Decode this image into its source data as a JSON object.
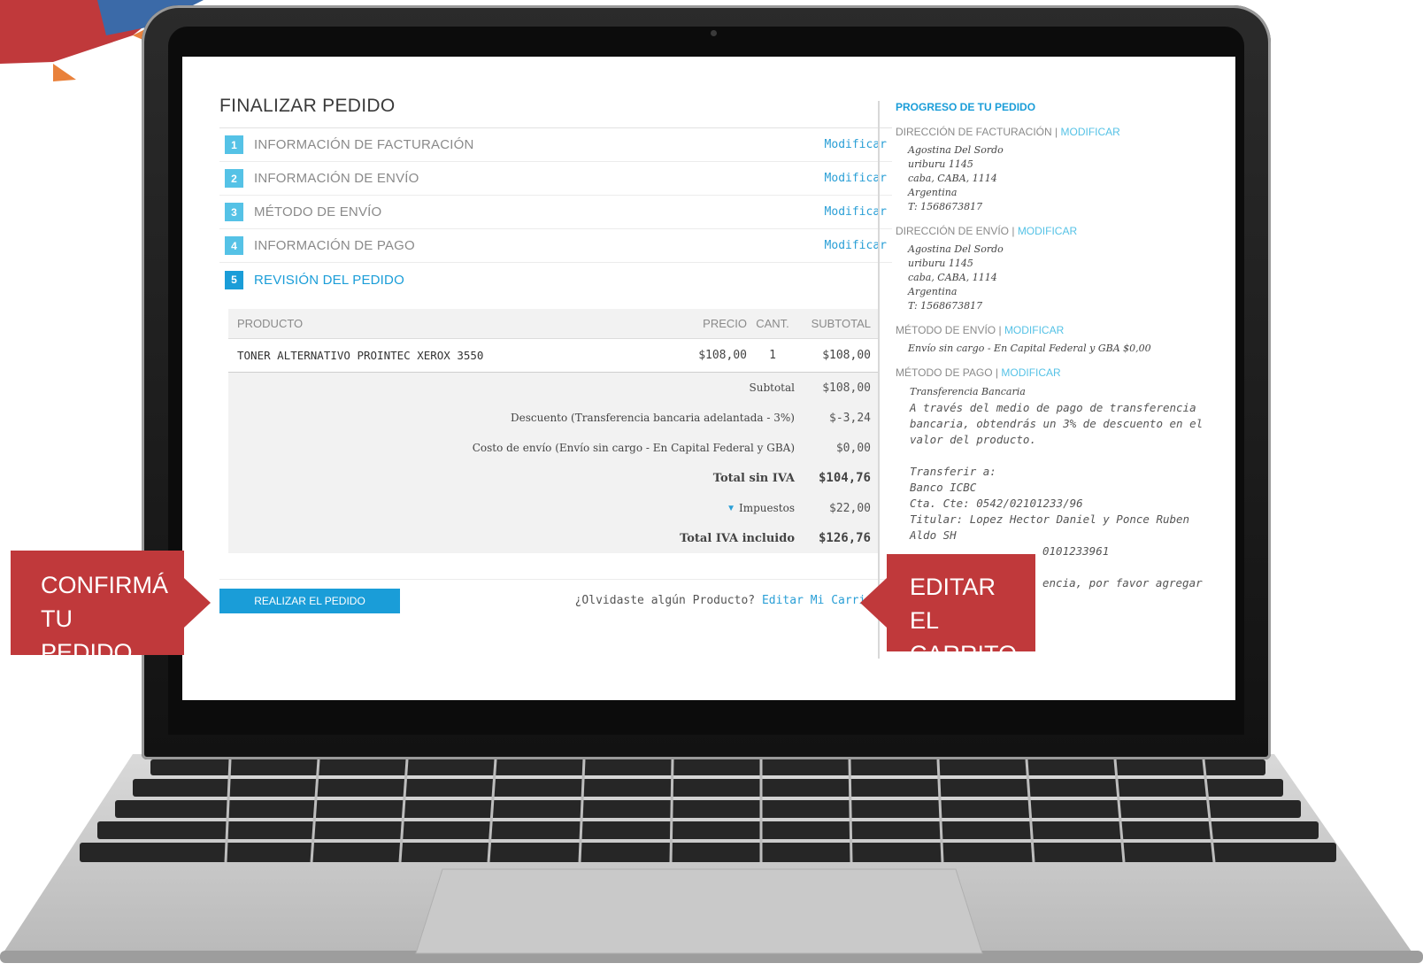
{
  "checkout": {
    "title": "FINALIZAR PEDIDO",
    "steps": [
      {
        "num": "1",
        "label": "INFORMACIÓN DE FACTURACIÓN",
        "action": "Modificar"
      },
      {
        "num": "2",
        "label": "INFORMACIÓN DE ENVÍO",
        "action": "Modificar"
      },
      {
        "num": "3",
        "label": "MÉTODO DE ENVÍO",
        "action": "Modificar"
      },
      {
        "num": "4",
        "label": "INFORMACIÓN DE PAGO",
        "action": "Modificar"
      },
      {
        "num": "5",
        "label": "REVISIÓN DEL PEDIDO"
      }
    ],
    "table": {
      "headers": {
        "product": "PRODUCTO",
        "price": "PRECIO",
        "qty": "CANT.",
        "subtotal": "SUBTOTAL"
      },
      "rows": [
        {
          "product": "TONER ALTERNATIVO PROINTEC XEROX 3550",
          "price": "$108,00",
          "qty": "1",
          "subtotal": "$108,00"
        }
      ],
      "totals": [
        {
          "label": "Subtotal",
          "value": "$108,00"
        },
        {
          "label": "Descuento (Transferencia bancaria adelantada - 3%)",
          "value": "$-3,24"
        },
        {
          "label": "Costo de envío (Envío sin cargo - En Capital Federal y GBA)",
          "value": "$0,00"
        },
        {
          "label": "Total sin IVA",
          "value": "$104,76"
        },
        {
          "label": "Impuestos",
          "value": "$22,00"
        },
        {
          "label": "Total IVA incluido",
          "value": "$126,76"
        }
      ]
    },
    "place_order_label": "REALIZAR EL PEDIDO",
    "forgot_text": "¿Olvidaste algún Producto?",
    "edit_cart_label": "Editar Mi Carrito"
  },
  "sidebar": {
    "title": "PROGRESO DE TU PEDIDO",
    "billing": {
      "heading": "DIRECCIÓN DE FACTURACIÓN",
      "modify": "MODIFICAR",
      "lines": [
        "Agostina Del Sordo",
        "uriburu 1145",
        "caba, CABA, 1114",
        "Argentina",
        "T: 1568673817"
      ]
    },
    "shipping": {
      "heading": "DIRECCIÓN DE ENVÍO",
      "modify": "MODIFICAR",
      "lines": [
        "Agostina Del Sordo",
        "uriburu 1145",
        "caba, CABA, 1114",
        "Argentina",
        "T: 1568673817"
      ]
    },
    "shipping_method": {
      "heading": "MÉTODO DE ENVÍO",
      "modify": "MODIFICAR",
      "text": "Envío sin cargo - En Capital Federal y GBA $0,00"
    },
    "payment": {
      "heading": "MÉTODO DE PAGO",
      "modify": "MODIFICAR",
      "title": "Transferencia Bancaria",
      "desc": "A través del medio de pago de transferencia bancaria, obtendrás un 3% de descuento en el valor del producto.",
      "transfer_to": "Transferir a:",
      "bank": "Banco ICBC",
      "account": "Cta. Cte: 0542/02101233/96",
      "holder": "Titular: Lopez Hector Daniel y Ponce Ruben Aldo SH",
      "cbu_partial": "0101233961",
      "note_partial": "encia, por favor agregar"
    }
  },
  "callouts": {
    "confirm_line1": "CONFIRMÁ",
    "confirm_line2": "TU PEDIDO",
    "edit_line1": "EDITAR EL",
    "edit_line2": "CARRITO"
  },
  "colors": {
    "accent": "#1a9dd8",
    "callout": "#c0393b"
  }
}
